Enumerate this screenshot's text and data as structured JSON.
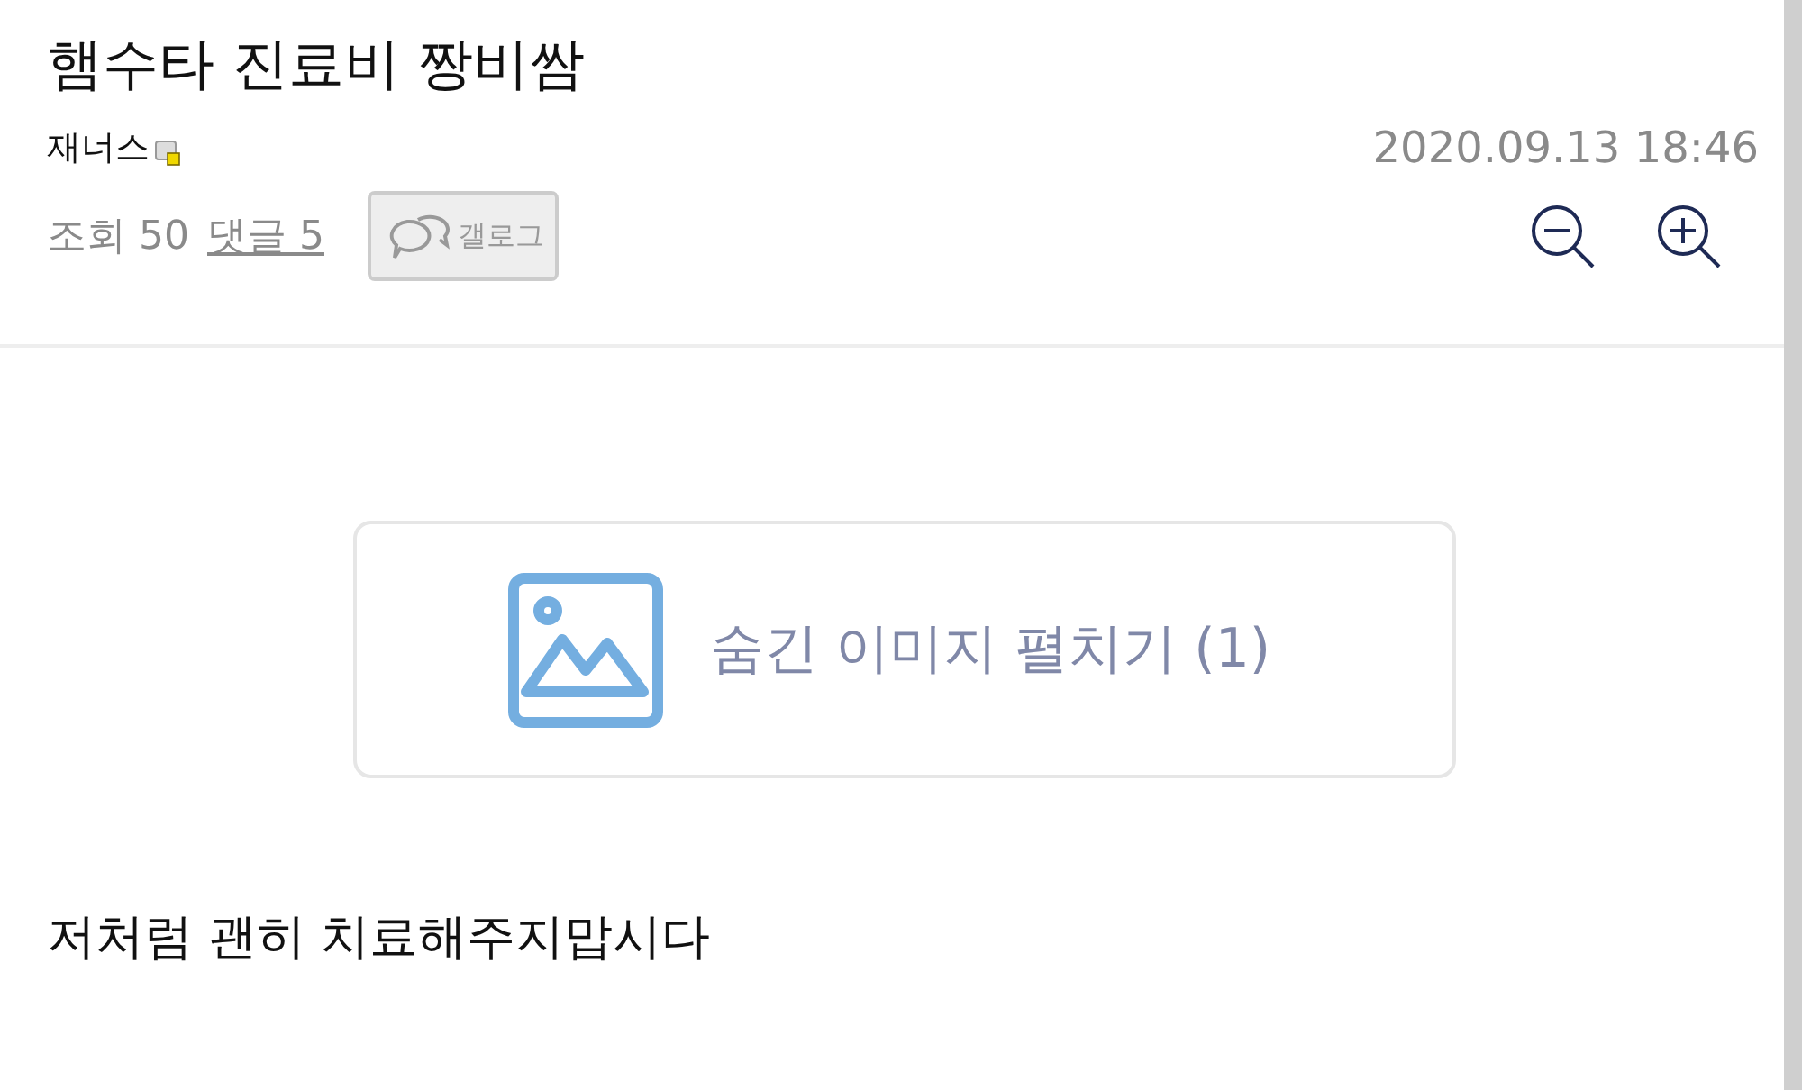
{
  "post": {
    "title": "햄수타 진료비 짱비쌈",
    "author": "재너스",
    "date": "2020.09.13 18:46",
    "views_label": "조회",
    "views": "50",
    "comments_label": "댓글 5",
    "gallog": "갤로그"
  },
  "hidden_images": {
    "label": "숨긴 이미지 펼치기 (1)"
  },
  "body": "저처럼 괜히 치료해주지맙시다"
}
